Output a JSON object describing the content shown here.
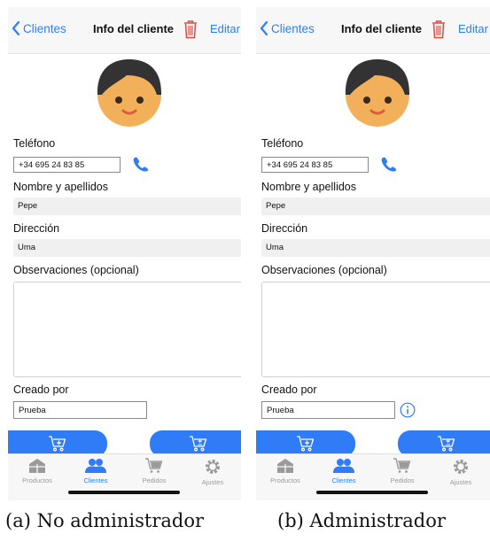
{
  "screens": [
    {
      "nav": {
        "back": "Clientes",
        "title": "Info del cliente",
        "edit": "Editar"
      },
      "fields": {
        "telefono_label": "Teléfono",
        "telefono_value": "+34 695 24 83 85",
        "nombre_label": "Nombre y apellidos",
        "nombre_value": "Pepe",
        "direccion_label": "Dirección",
        "direccion_value": "Uma",
        "observaciones_label": "Observaciones (opcional)",
        "observaciones_value": "",
        "creado_label": "Creado por",
        "creado_value": "Prueba"
      },
      "tabs": [
        "Productos",
        "Clientes",
        "Pedidos",
        "Ajustes"
      ],
      "active_tab": "Clientes",
      "show_info_icon": false,
      "caption": "(a) No administrador"
    },
    {
      "nav": {
        "back": "Clientes",
        "title": "Info del cliente",
        "edit": "Editar"
      },
      "fields": {
        "telefono_label": "Teléfono",
        "telefono_value": "+34 695 24 83 85",
        "nombre_label": "Nombre y apellidos",
        "nombre_value": "Pepe",
        "direccion_label": "Dirección",
        "direccion_value": "Uma",
        "observaciones_label": "Observaciones (opcional)",
        "observaciones_value": "",
        "creado_label": "Creado por",
        "creado_value": "Prueba"
      },
      "tabs": [
        "Productos",
        "Clientes",
        "Pedidos",
        "Ajustes"
      ],
      "active_tab": "Clientes",
      "show_info_icon": true,
      "caption": "(b) Administrador"
    }
  ],
  "colors": {
    "accent": "#2f7cf6",
    "danger": "#e0483e",
    "inactive": "#9a9a9a",
    "avatar_skin": "#f3b05a",
    "avatar_hair": "#333333"
  },
  "icons": {
    "back": "chevron-left-icon",
    "delete": "trash-icon",
    "call": "phone-icon",
    "info": "info-circle-icon",
    "fab_left": "cart-add-icon",
    "fab_right": "cart-calculator-icon",
    "tabs": [
      "store-icon",
      "users-icon",
      "cart-icon",
      "gear-icon"
    ]
  }
}
